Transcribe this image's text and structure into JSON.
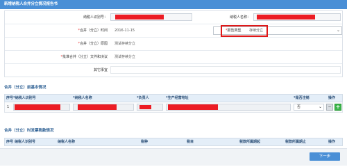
{
  "window": {
    "title": "新增纳税人合并分立情况报告书"
  },
  "form": {
    "taxpayer_id_label": "纳税人识别号：",
    "taxpayer_name_label": "纳税人名称：",
    "time_label": "合并（分立）时间",
    "time_value": "2016-11-15",
    "report_type_label": "报告类型",
    "report_type_value": "存续分立",
    "reason_label": "合并（分立）原因",
    "reason_value": "测试存续分立",
    "doc_label": "批准合并（分立）文件和决议",
    "doc_value": "测试存续分立",
    "other_label": "其它事宜",
    "required_mark": "*"
  },
  "section1": {
    "title": "合并（分立）前基本情况",
    "columns": [
      "序号",
      "*纳税人识别号",
      "*纳税人名称",
      "*负责人",
      "*生产经营地址",
      "*是否注销",
      "操作"
    ],
    "rows": [
      {
        "index": "1",
        "cancel_value": "否"
      }
    ],
    "remove_button": "−",
    "add_button": "+"
  },
  "section2": {
    "title": "合并（分立）时发票税款情况",
    "columns": [
      "序号",
      "纳税人识别号",
      "纳税人名称",
      "税种",
      "税目",
      "税款所属期起",
      "税款所属期止",
      "操作"
    ]
  },
  "footer": {
    "next_button": "下一步"
  },
  "colors": {
    "accent": "#4a8fd6",
    "redaction": "#ec1c24",
    "highlight": "#e01818",
    "add_green": "#3bb54a"
  }
}
